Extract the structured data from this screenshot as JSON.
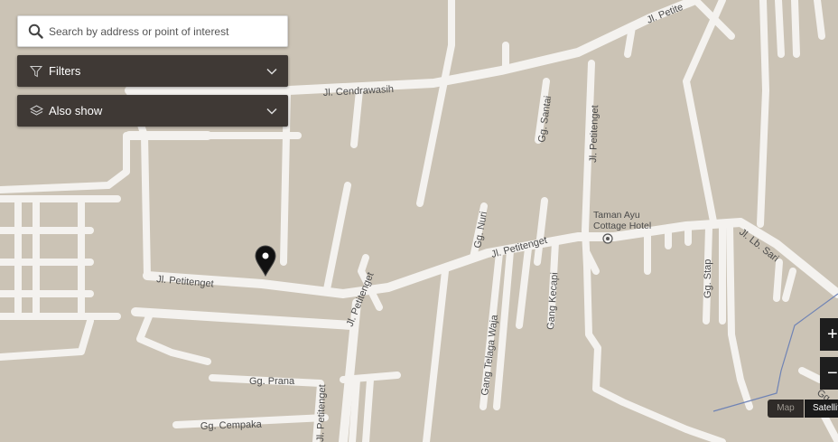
{
  "search": {
    "placeholder": "Search by address or point of interest",
    "icon": "search-icon"
  },
  "filters": {
    "label": "Filters",
    "icon": "funnel-icon"
  },
  "also_show": {
    "label": "Also show",
    "icon": "layers-icon"
  },
  "map": {
    "background_color": "#cbc3b5",
    "road_color": "#f4f2ef",
    "streets": {
      "petitenget_west": "Jl. Petitenget",
      "petitenget_south": "Jl. Petitenget",
      "petitenget_east": "Jl. Petitenget",
      "petitenget_vertical": "Jl. Petitenget",
      "petitenget_top": "Jl. Petite",
      "cendrawasih": "Jl. Cendrawasih",
      "santai": "Gg. Santai",
      "nuri": "Gg. Nuri",
      "kecapi": "Gang Kecapi",
      "telaga_waja": "Gang Telaga Waja",
      "stap": "Gg. Stap",
      "lb_sari": "Jl. Lb. Sari",
      "prana": "Gg. Prana",
      "cempaka": "Gg. Cempaka",
      "bottom_edge": "Jl. Petitenget",
      "right_edge": "Gg. Ma"
    },
    "poi": {
      "line1": "Taman Ayu",
      "line2": "Cottage Hotel"
    }
  },
  "controls": {
    "zoom_in": "+",
    "zoom_out": "−",
    "map_type_map": "Map",
    "map_type_satellite": "Satellite"
  }
}
